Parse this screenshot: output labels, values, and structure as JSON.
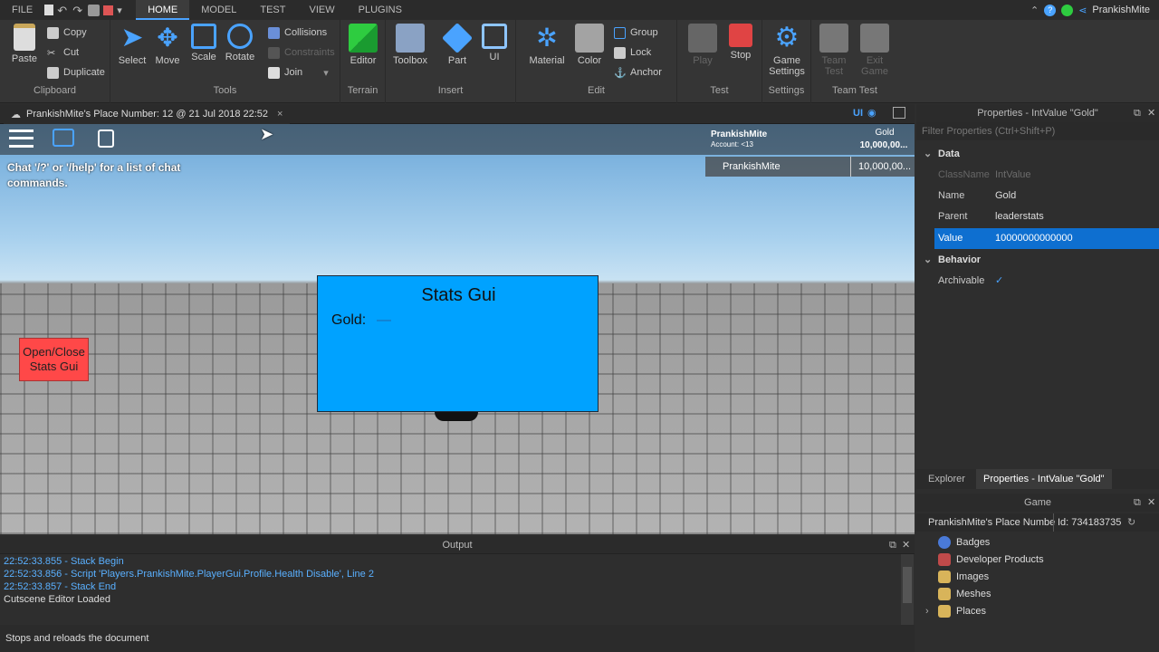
{
  "menu": {
    "file": "FILE",
    "tabs": [
      "HOME",
      "MODEL",
      "TEST",
      "VIEW",
      "PLUGINS"
    ],
    "user": "PrankishMite"
  },
  "ribbon": {
    "clipboard": {
      "paste": "Paste",
      "copy": "Copy",
      "cut": "Cut",
      "duplicate": "Duplicate",
      "label": "Clipboard"
    },
    "tools": {
      "select": "Select",
      "move": "Move",
      "scale": "Scale",
      "rotate": "Rotate",
      "collisions": "Collisions",
      "constraints": "Constraints",
      "join": "Join",
      "label": "Tools"
    },
    "terrain": {
      "editor": "Editor",
      "label": "Terrain"
    },
    "insert": {
      "toolbox": "Toolbox",
      "part": "Part",
      "ui": "UI",
      "label": "Insert"
    },
    "edit": {
      "material": "Material",
      "color": "Color",
      "group": "Group",
      "lock": "Lock",
      "anchor": "Anchor",
      "label": "Edit"
    },
    "test": {
      "play": "Play",
      "stop": "Stop",
      "label": "Test"
    },
    "settings": {
      "game_settings_1": "Game",
      "game_settings_2": "Settings",
      "label": "Settings"
    },
    "teamtest": {
      "team_1": "Team",
      "team_2": "Test",
      "exit_1": "Exit",
      "exit_2": "Game",
      "label": "Team Test"
    }
  },
  "doc_tab": {
    "title": "PrankishMite's Place Number: 12 @ 21 Jul 2018 22:52",
    "close": "×",
    "ui_toggle": "UI"
  },
  "viewport": {
    "leaderboard": {
      "player_name": "PrankishMite",
      "account": "Account: <13",
      "stat_name": "Gold",
      "stat_value": "10,000,00...",
      "row_name": "PrankishMite",
      "row_value": "10,000,00..."
    },
    "chat_hint": "Chat '/?' or '/help' for a list of chat commands.",
    "stats_gui": {
      "title": "Stats Gui",
      "gold_label": "Gold:",
      "gold_value": "—"
    },
    "open_close": "Open/Close Stats Gui"
  },
  "output": {
    "title": "Output",
    "lines": [
      {
        "text": "22:52:33.855 - Stack Begin",
        "color": "#5ab0ff"
      },
      {
        "text": "22:52:33.856 - Script 'Players.PrankishMite.PlayerGui.Profile.Health Disable', Line 2",
        "color": "#5ab0ff"
      },
      {
        "text": "22:52:33.857 - Stack End",
        "color": "#5ab0ff"
      },
      {
        "text": "Cutscene Editor Loaded",
        "color": "#dddddd"
      }
    ]
  },
  "status": "Stops and reloads the document",
  "properties": {
    "title": "Properties - IntValue \"Gold\"",
    "filter_placeholder": "Filter Properties (Ctrl+Shift+P)",
    "section_data": "Data",
    "section_behavior": "Behavior",
    "classname_key": "ClassName",
    "classname_val": "IntValue",
    "name_key": "Name",
    "name_val": "Gold",
    "parent_key": "Parent",
    "parent_val": "leaderstats",
    "value_key": "Value",
    "value_val": "10000000000000",
    "archivable_key": "Archivable",
    "archivable_val": "✓",
    "tab_explorer": "Explorer",
    "tab_properties": "Properties - IntValue \"Gold\""
  },
  "game": {
    "title": "Game",
    "place_name": "PrankishMite's Place Numbe",
    "place_id": "Id: 734183735",
    "items": [
      "Badges",
      "Developer Products",
      "Images",
      "Meshes",
      "Places"
    ]
  },
  "colors": {
    "accent": "#4aa3ff",
    "stats_gui": "#00a2ff",
    "open_close": "#ff4848",
    "value_selected": "#0e6fd0"
  }
}
